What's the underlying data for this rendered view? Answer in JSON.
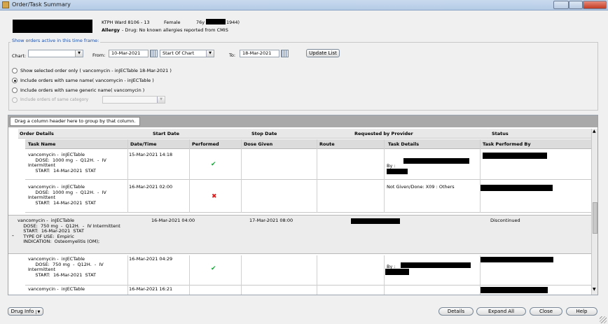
{
  "window": {
    "title": "Order/Task Summary"
  },
  "patient": {
    "ward": "KTPH Ward 8106 - 13",
    "sex": "Female",
    "age": "76y",
    "dob_suffix": "1944)",
    "allergy_label": "Allergy",
    "allergy_text": "- Drug: No known allergies reported from CMIS"
  },
  "filter": {
    "section_title": "Show orders active in this time frame:",
    "chart_label": "Chart:",
    "chart_value": "",
    "from_label": "From:",
    "from_date": "10-Mar-2021",
    "start_of_chart": "Start Of Chart",
    "to_label": "To:",
    "to_date": "18-Mar-2021",
    "update_button": "Update List"
  },
  "options": [
    {
      "label": "Show selected order only",
      "suffix": "( vancomycin -  inJECTable 18-Mar-2021 )",
      "selected": false,
      "enabled": true
    },
    {
      "label": "Include orders with same name",
      "suffix": "( vancomycin -  inJECTable )",
      "selected": true,
      "enabled": true
    },
    {
      "label": "Include orders with same generic name",
      "suffix": "( vancomycin )",
      "selected": false,
      "enabled": true
    },
    {
      "label": "Include orders of same category",
      "suffix": "",
      "selected": false,
      "enabled": false
    }
  ],
  "grid": {
    "group_hint": "Drag a column header here to group by that column.",
    "order_columns": [
      "Order Details",
      "Start Date",
      "Stop Date",
      "Requested by Provider",
      "Status"
    ],
    "task_columns": [
      "Task Name",
      "Date/Time",
      "Performed",
      "Dose Given",
      "Route",
      "Task Details",
      "Task Performed By"
    ],
    "tasks_block1": [
      {
        "name": [
          "vancomycin -  inJECTable",
          "     DOSE:  1000 mg  -  Q12H.  -  IV",
          "Intermittent",
          "     START:  14-Mar-2021  STAT"
        ],
        "datetime": "15-Mar-2021 14:18",
        "performed": "check",
        "details": "By :"
      },
      {
        "name": [
          "vancomycin -  inJECTable",
          "     DOSE:  1000 mg  -  Q12H.  -  IV",
          "Intermittent",
          "     START:  14-Mar-2021  STAT"
        ],
        "datetime": "16-Mar-2021 02:00",
        "performed": "cross",
        "details": "Not Given/Done: X09 : Others"
      }
    ],
    "order2": {
      "expander": "-",
      "details": [
        "vancomycin -  inJECTable",
        "    DOSE:  750 mg  -  Q12H.  -  IV Intermittent",
        "    START:  16-Mar-2021  STAT",
        "    TYPE OF USE:  Empiric",
        "    INDICATION:  Osteomyelitis (OM);"
      ],
      "start": "16-Mar-2021 04:00",
      "stop": "17-Mar-2021 08:00",
      "status": "Discontinued"
    },
    "tasks_block2": [
      {
        "name": [
          "vancomycin -  inJECTable",
          "     DOSE:  750 mg  -  Q12H.  -  IV",
          "Intermittent",
          "     START:  16-Mar-2021  STAT"
        ],
        "datetime": "16-Mar-2021 04:29",
        "performed": "check",
        "details": "By :"
      },
      {
        "name": [
          "vancomycin -  inJECTable"
        ],
        "datetime": "16-Mar-2021 16:21",
        "performed": "",
        "details": ""
      }
    ]
  },
  "footer": {
    "drug_info": "Drug Info",
    "details": "Details",
    "expand_all": "Expand All",
    "close": "Close",
    "help": "Help"
  },
  "icons": {
    "check": "✔",
    "cross": "✖",
    "dropdown": "▼",
    "scroll_up": "▲",
    "scroll_down": "▼"
  }
}
